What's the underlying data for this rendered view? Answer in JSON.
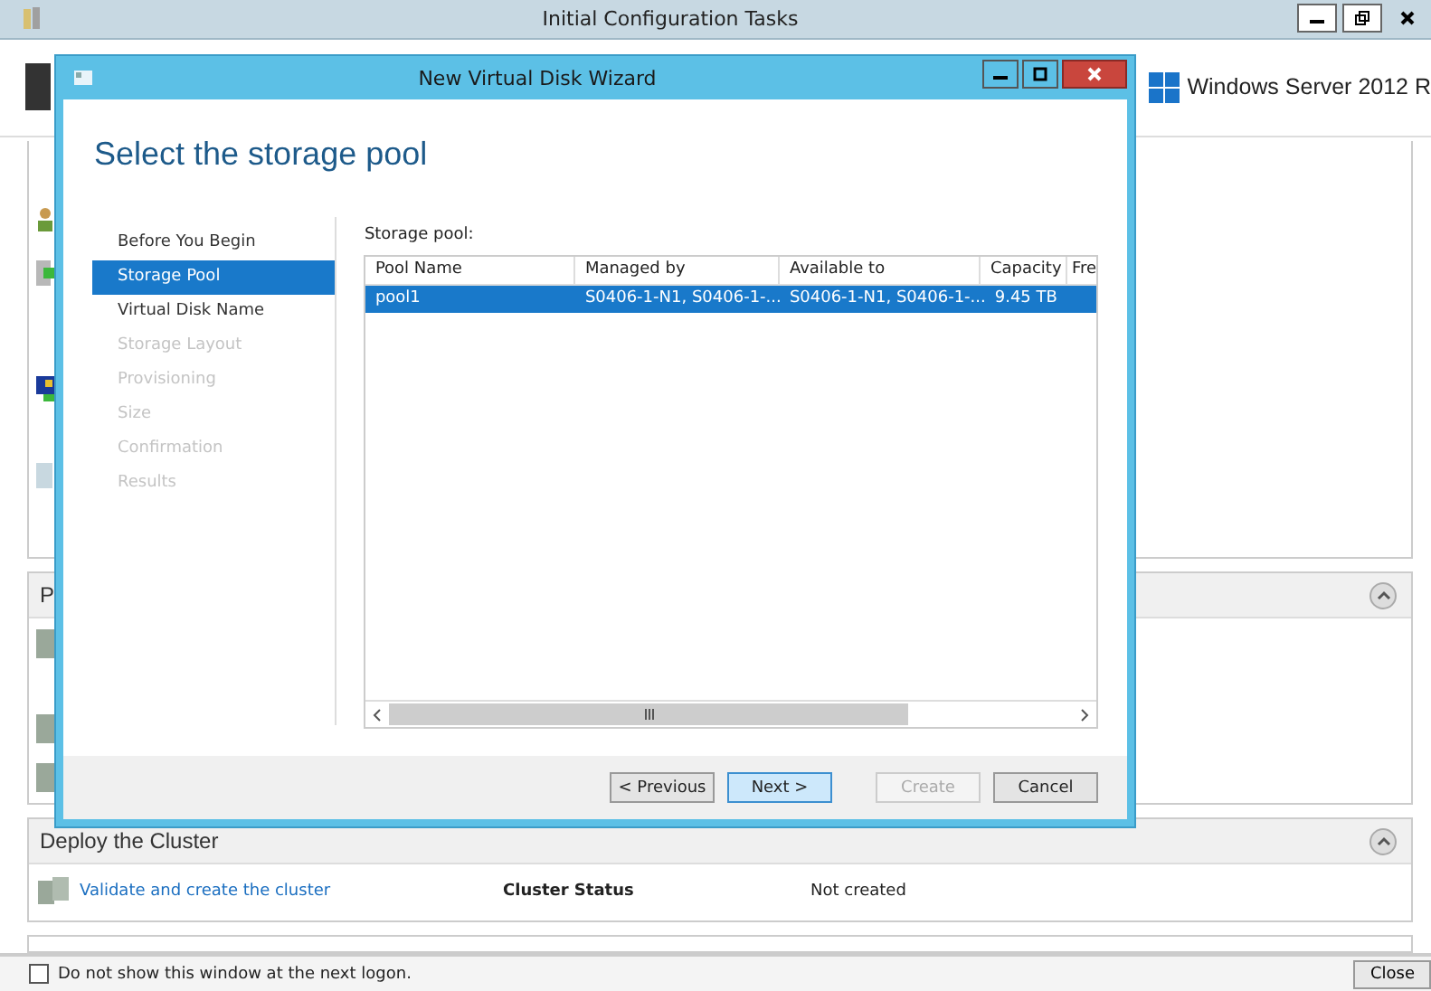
{
  "window": {
    "title": "Initial Configuration Tasks",
    "brand": "Windows Server 2012 R"
  },
  "sections": [
    {
      "title": "P",
      "expanded": true
    },
    {
      "title": "Deploy the Cluster",
      "expanded": true,
      "link": "Validate and create the cluster",
      "status_label": "Cluster Status",
      "status_value": "Not created"
    }
  ],
  "footer": {
    "checkbox_label": "Do not show this window at the next logon.",
    "checked": false,
    "close": "Close"
  },
  "wizard": {
    "title": "New Virtual Disk Wizard",
    "heading": "Select the storage pool",
    "steps": [
      {
        "label": "Before You Begin",
        "selected": false,
        "disabled": false
      },
      {
        "label": "Storage Pool",
        "selected": true,
        "disabled": false
      },
      {
        "label": "Virtual Disk Name",
        "selected": false,
        "disabled": false
      },
      {
        "label": "Storage Layout",
        "selected": false,
        "disabled": true
      },
      {
        "label": "Provisioning",
        "selected": false,
        "disabled": true
      },
      {
        "label": "Size",
        "selected": false,
        "disabled": true
      },
      {
        "label": "Confirmation",
        "selected": false,
        "disabled": true
      },
      {
        "label": "Results",
        "selected": false,
        "disabled": true
      }
    ],
    "list_label": "Storage pool:",
    "columns": [
      "Pool Name",
      "Managed by",
      "Available to",
      "Capacity",
      "Fre"
    ],
    "rows": [
      {
        "cells": [
          "pool1",
          "S0406-1-N1, S0406-1-...",
          "S0406-1-N1, S0406-1-...",
          "9.45 TB"
        ],
        "selected": true
      }
    ],
    "buttons": [
      {
        "label": "< Previous",
        "disabled": false,
        "focused": false
      },
      {
        "label": "Next >",
        "disabled": false,
        "focused": true
      },
      {
        "label": "Create",
        "disabled": true,
        "focused": false
      },
      {
        "label": "Cancel",
        "disabled": false,
        "focused": false
      }
    ]
  }
}
